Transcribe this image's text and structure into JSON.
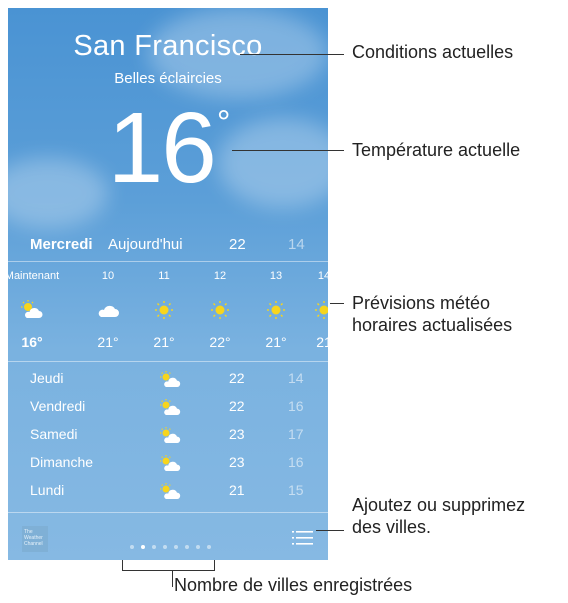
{
  "location": {
    "city": "San Francisco",
    "condition": "Belles éclaircies",
    "temperature": "16",
    "degree_symbol": "°"
  },
  "today": {
    "day": "Mercredi",
    "label": "Aujourd'hui",
    "high": "22",
    "low": "14"
  },
  "hourly": [
    {
      "time": "Maintenant",
      "icon": "partly-cloudy-icon",
      "temp": "16°"
    },
    {
      "time": "10",
      "icon": "cloud-icon",
      "temp": "21°"
    },
    {
      "time": "11",
      "icon": "sun-icon",
      "temp": "21°"
    },
    {
      "time": "12",
      "icon": "sun-icon",
      "temp": "22°"
    },
    {
      "time": "13",
      "icon": "sun-icon",
      "temp": "21°"
    },
    {
      "time": "14",
      "icon": "sun-icon",
      "temp": "21"
    }
  ],
  "daily": [
    {
      "day": "Jeudi",
      "icon": "partly-cloudy-icon",
      "high": "22",
      "low": "14"
    },
    {
      "day": "Vendredi",
      "icon": "partly-cloudy-icon",
      "high": "22",
      "low": "16"
    },
    {
      "day": "Samedi",
      "icon": "partly-cloudy-icon",
      "high": "23",
      "low": "17"
    },
    {
      "day": "Dimanche",
      "icon": "partly-cloudy-icon",
      "high": "23",
      "low": "16"
    },
    {
      "day": "Lundi",
      "icon": "partly-cloudy-icon",
      "high": "21",
      "low": "15"
    }
  ],
  "toolbar": {
    "logo_text": "The Weather Channel",
    "page_count": 8,
    "active_page": 2
  },
  "callouts": {
    "conditions": "Conditions actuelles",
    "temperature": "Température actuelle",
    "hourly_line1": "Prévisions météo",
    "hourly_line2": "horaires actualisées",
    "cities_line1": "Ajoutez ou supprimez",
    "cities_line2": "des villes.",
    "saved_cities": "Nombre de villes enregistrées"
  },
  "colors": {
    "sky_top": "#4a93d3",
    "sky_bottom": "#86b9e3",
    "sun": "#f7d51d",
    "text": "#ffffff"
  }
}
